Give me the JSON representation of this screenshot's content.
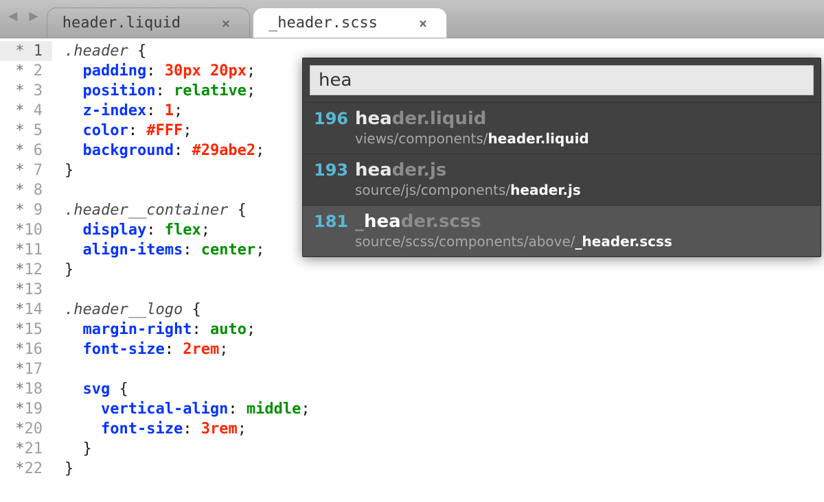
{
  "tabs": [
    {
      "label": "header.liquid",
      "active": false
    },
    {
      "label": "_header.scss",
      "active": true
    }
  ],
  "gutter": {
    "modified_marker": "*",
    "lines": [
      "1",
      "2",
      "3",
      "4",
      "5",
      "6",
      "7",
      "8",
      "9",
      "10",
      "11",
      "12",
      "13",
      "14",
      "15",
      "16",
      "17",
      "18",
      "19",
      "20",
      "21",
      "22"
    ]
  },
  "code_lines": [
    [
      {
        "t": ".header ",
        "c": "c-sel"
      },
      {
        "t": "{",
        "c": "c-punct"
      }
    ],
    [
      {
        "t": "  "
      },
      {
        "t": "padding",
        "c": "c-prop"
      },
      {
        "t": ": "
      },
      {
        "t": "30",
        "c": "c-num"
      },
      {
        "t": "px",
        "c": "c-unit"
      },
      {
        "t": " "
      },
      {
        "t": "20",
        "c": "c-num"
      },
      {
        "t": "px",
        "c": "c-unit"
      },
      {
        "t": ";",
        "c": "c-semi"
      }
    ],
    [
      {
        "t": "  "
      },
      {
        "t": "position",
        "c": "c-prop"
      },
      {
        "t": ": "
      },
      {
        "t": "relative",
        "c": "c-kw"
      },
      {
        "t": ";",
        "c": "c-semi"
      }
    ],
    [
      {
        "t": "  "
      },
      {
        "t": "z-index",
        "c": "c-prop"
      },
      {
        "t": ": "
      },
      {
        "t": "1",
        "c": "c-num"
      },
      {
        "t": ";",
        "c": "c-semi"
      }
    ],
    [
      {
        "t": "  "
      },
      {
        "t": "color",
        "c": "c-prop"
      },
      {
        "t": ": "
      },
      {
        "t": "#FFF",
        "c": "c-hex"
      },
      {
        "t": ";",
        "c": "c-semi"
      }
    ],
    [
      {
        "t": "  "
      },
      {
        "t": "background",
        "c": "c-prop"
      },
      {
        "t": ": "
      },
      {
        "t": "#29abe2",
        "c": "c-hex"
      },
      {
        "t": ";",
        "c": "c-semi"
      }
    ],
    [
      {
        "t": "}",
        "c": "c-punct"
      }
    ],
    [
      {
        "t": " "
      }
    ],
    [
      {
        "t": ".header__container ",
        "c": "c-sel"
      },
      {
        "t": "{",
        "c": "c-punct"
      }
    ],
    [
      {
        "t": "  "
      },
      {
        "t": "display",
        "c": "c-prop"
      },
      {
        "t": ": "
      },
      {
        "t": "flex",
        "c": "c-kw"
      },
      {
        "t": ";",
        "c": "c-semi"
      }
    ],
    [
      {
        "t": "  "
      },
      {
        "t": "align-items",
        "c": "c-prop"
      },
      {
        "t": ": "
      },
      {
        "t": "center",
        "c": "c-kw"
      },
      {
        "t": ";",
        "c": "c-semi"
      }
    ],
    [
      {
        "t": "}",
        "c": "c-punct"
      }
    ],
    [
      {
        "t": " "
      }
    ],
    [
      {
        "t": ".header__logo ",
        "c": "c-sel"
      },
      {
        "t": "{",
        "c": "c-punct"
      }
    ],
    [
      {
        "t": "  "
      },
      {
        "t": "margin-right",
        "c": "c-prop"
      },
      {
        "t": ": "
      },
      {
        "t": "auto",
        "c": "c-kw"
      },
      {
        "t": ";",
        "c": "c-semi"
      }
    ],
    [
      {
        "t": "  "
      },
      {
        "t": "font-size",
        "c": "c-prop"
      },
      {
        "t": ": "
      },
      {
        "t": "2",
        "c": "c-num"
      },
      {
        "t": "rem",
        "c": "c-unit"
      },
      {
        "t": ";",
        "c": "c-semi"
      }
    ],
    [
      {
        "t": " "
      }
    ],
    [
      {
        "t": "  "
      },
      {
        "t": "svg ",
        "c": "c-tag"
      },
      {
        "t": "{",
        "c": "c-punct"
      }
    ],
    [
      {
        "t": "    "
      },
      {
        "t": "vertical-align",
        "c": "c-prop"
      },
      {
        "t": ": "
      },
      {
        "t": "middle",
        "c": "c-kw"
      },
      {
        "t": ";",
        "c": "c-semi"
      }
    ],
    [
      {
        "t": "    "
      },
      {
        "t": "font-size",
        "c": "c-prop"
      },
      {
        "t": ": "
      },
      {
        "t": "3",
        "c": "c-num"
      },
      {
        "t": "rem",
        "c": "c-unit"
      },
      {
        "t": ";",
        "c": "c-semi"
      }
    ],
    [
      {
        "t": "  "
      },
      {
        "t": "}",
        "c": "c-punct"
      }
    ],
    [
      {
        "t": "}",
        "c": "c-punct"
      }
    ]
  ],
  "finder": {
    "query": "hea",
    "results": [
      {
        "score": "196",
        "name_parts": [
          {
            "t": "hea",
            "m": true
          },
          {
            "t": "der.liquid",
            "m": false
          }
        ],
        "path_parts": [
          {
            "t": "views/components/",
            "m": false
          },
          {
            "t": "header.liquid",
            "m": true
          }
        ],
        "selected": false
      },
      {
        "score": "193",
        "name_parts": [
          {
            "t": "hea",
            "m": true
          },
          {
            "t": "der.js",
            "m": false
          }
        ],
        "path_parts": [
          {
            "t": "source/js/components/",
            "m": false
          },
          {
            "t": "header.js",
            "m": true
          }
        ],
        "selected": false
      },
      {
        "score": "181",
        "name_parts": [
          {
            "t": "_",
            "m": false
          },
          {
            "t": "hea",
            "m": true
          },
          {
            "t": "der.scss",
            "m": false
          }
        ],
        "path_parts": [
          {
            "t": "source/scss/components/above/",
            "m": false
          },
          {
            "t": "_header.scss",
            "m": true
          }
        ],
        "selected": true
      }
    ]
  }
}
